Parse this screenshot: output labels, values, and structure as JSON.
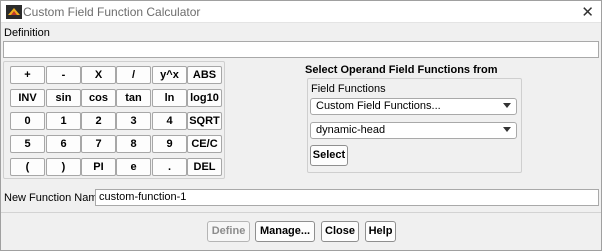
{
  "window": {
    "title": "Custom Field Function Calculator",
    "close_glyph": "✕",
    "icon": "fluent-logo-icon"
  },
  "definition": {
    "label": "Definition",
    "value": ""
  },
  "keypad": {
    "keys": [
      [
        "+",
        "-",
        "X",
        "/",
        "y^x",
        "ABS"
      ],
      [
        "INV",
        "sin",
        "cos",
        "tan",
        "ln",
        "log10"
      ],
      [
        "0",
        "1",
        "2",
        "3",
        "4",
        "SQRT"
      ],
      [
        "5",
        "6",
        "7",
        "8",
        "9",
        "CE/C"
      ],
      [
        "(",
        ")",
        "PI",
        "e",
        ".",
        "DEL"
      ]
    ]
  },
  "operand": {
    "title": "Select Operand Field Functions from",
    "field_functions_label": "Field Functions",
    "category_selected": "Custom Field Functions...",
    "function_selected": "dynamic-head",
    "select_label": "Select"
  },
  "new_function": {
    "label": "New Function Name",
    "value": "custom-function-1"
  },
  "actions": {
    "define_label": "Define",
    "manage_label": "Manage...",
    "close_label": "Close",
    "help_label": "Help"
  }
}
